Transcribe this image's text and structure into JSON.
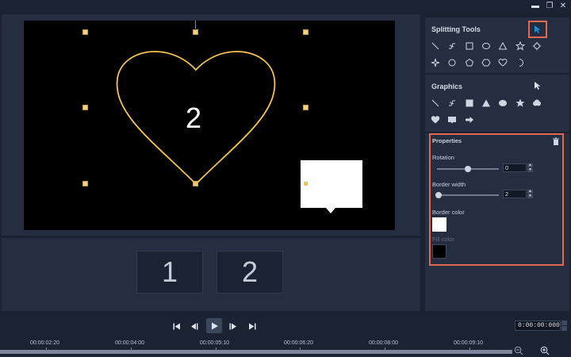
{
  "window_controls": {
    "minimize": "▬",
    "restore": "❐",
    "close": "✕"
  },
  "preview": {
    "heart_number": "2"
  },
  "clips": [
    {
      "label": "1"
    },
    {
      "label": "2"
    }
  ],
  "splitting_tools": {
    "title": "Splitting Tools",
    "tools": [
      "line-icon",
      "polyline-icon",
      "square-icon",
      "circle-icon",
      "triangle-icon",
      "gear-shape-icon",
      "sparkle-icon",
      "circle-outline-icon",
      "pentagon-icon",
      "hexagon-icon",
      "heart-icon",
      "crescent-icon"
    ]
  },
  "graphics": {
    "title": "Graphics",
    "tools": [
      "line-icon",
      "polyline-icon",
      "filled-square-icon",
      "filled-triangle-icon",
      "filled-circle-icon",
      "filled-star-icon",
      "filled-cloud-icon",
      "filled-heart-icon",
      "speech-bubble-icon",
      "arrow-right-icon"
    ]
  },
  "properties": {
    "title": "Properties",
    "rotation_label": "Rotation",
    "rotation_value": "0",
    "rotation_fraction": 0.5,
    "border_width_label": "Border width",
    "border_width_value": "2",
    "border_width_fraction": 0.02,
    "border_color_label": "Border color",
    "border_color": "#ffffff",
    "fill_color_label": "Fill color",
    "fill_color": "#000000"
  },
  "transport": {
    "timecode": "0:00:00:000"
  },
  "ruler": [
    "00:00:02:20",
    "00:00:04:00",
    "00:00:05:10",
    "00:00:06:20",
    "00:00:08:00",
    "00:00:09:10"
  ],
  "colors": {
    "accent": "#e4684f",
    "cursor_blue": "#1d8fe0",
    "heart_stroke": "#f3c34a"
  }
}
